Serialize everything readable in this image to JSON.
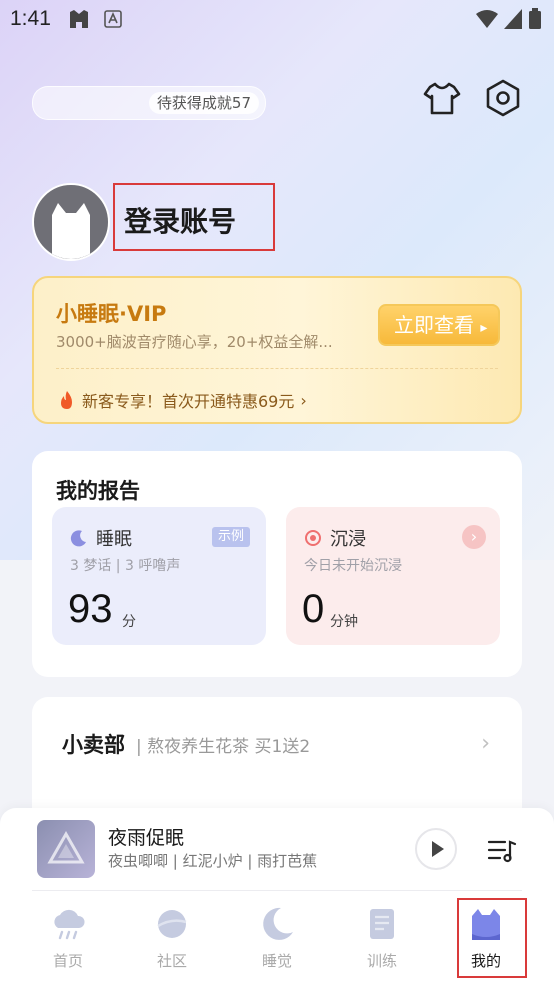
{
  "status_bar": {
    "time": "1:41"
  },
  "header": {
    "achievement_text": "待获得成就57"
  },
  "profile": {
    "login_text": "登录账号"
  },
  "vip": {
    "title": "小睡眠·VIP",
    "subtitle": "3000+脑波音疗随心享，20+权益全解...",
    "button_label": "立即查看",
    "offer_text": "新客专享！首次开通特惠69元"
  },
  "report": {
    "title": "我的报告",
    "sleep": {
      "label": "睡眠",
      "tag": "示例",
      "meta": "3 梦话 | 3 呼噜声",
      "value": "93",
      "unit": "分"
    },
    "immerse": {
      "label": "沉浸",
      "meta": "今日未开始沉浸",
      "value": "0",
      "unit": "分钟"
    }
  },
  "shop": {
    "title": "小卖部",
    "subtitle": "熬夜养生花茶 买1送2"
  },
  "player": {
    "title": "夜雨促眠",
    "subtitle": "夜虫唧唧 | 红泥小炉 | 雨打芭蕉"
  },
  "tabs": [
    {
      "label": "首页",
      "icon": "cloud-rain-icon"
    },
    {
      "label": "社区",
      "icon": "planet-icon"
    },
    {
      "label": "睡觉",
      "icon": "moon-icon"
    },
    {
      "label": "训练",
      "icon": "notebook-icon"
    },
    {
      "label": "我的",
      "icon": "cat-icon"
    }
  ],
  "colors": {
    "accent_gold": "#c77a10",
    "active_highlight": "#d93a3a"
  }
}
